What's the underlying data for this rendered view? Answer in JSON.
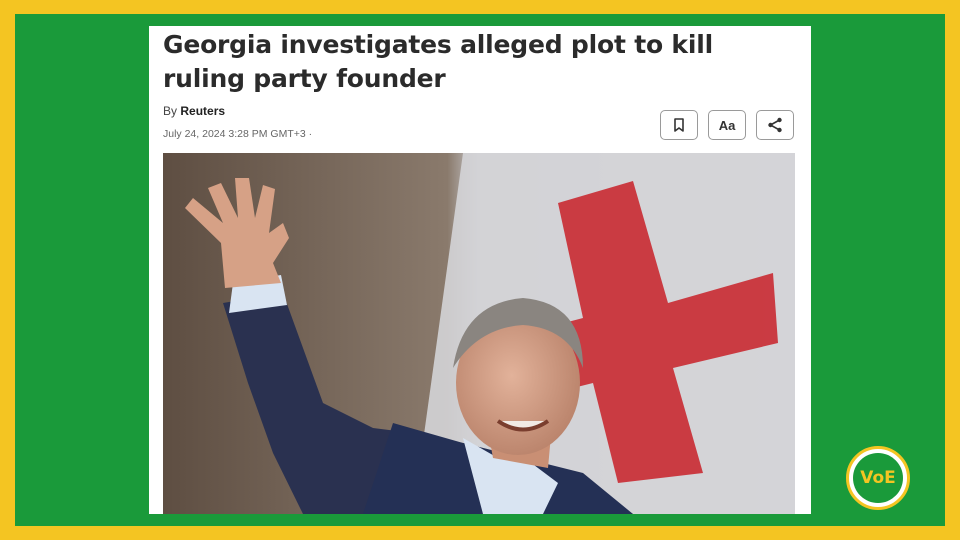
{
  "article": {
    "headline": "Georgia investigates alleged plot to kill ruling party founder",
    "byline_prefix": "By",
    "byline_author": "Reuters",
    "dateline": "July 24, 2024 3:28 PM GMT+3 ·",
    "font_button_label": "Aa"
  },
  "icons": {
    "bookmark": "bookmark-icon",
    "share": "share-icon"
  },
  "badge": {
    "logo_text": "VoE"
  },
  "colors": {
    "outer_frame": "#f4c522",
    "inner_frame": "#1a9a3a",
    "card_background": "#ffffff",
    "flag_cross": "#c8262d"
  }
}
